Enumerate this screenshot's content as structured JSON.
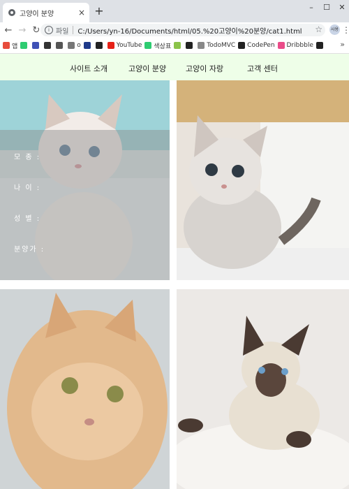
{
  "browser": {
    "tab_title": "고양이 분양",
    "new_tab": "+",
    "window_controls": {
      "minimize": "–",
      "maximize": "☐",
      "close": "✕"
    },
    "address": {
      "scheme_label": "파일",
      "url": "C:/Users/yn-16/Documents/html/05.%20고양이%20분양/cat1.html"
    },
    "profile_label": "사용",
    "bookmarks": [
      {
        "label": "앱",
        "color": "#e74c3c"
      },
      {
        "label": "",
        "color": "#2ecc71"
      },
      {
        "label": "",
        "color": "#3f51b5"
      },
      {
        "label": "",
        "color": "#333333"
      },
      {
        "label": "",
        "color": "#555555"
      },
      {
        "label": "o",
        "color": "#777777"
      },
      {
        "label": "",
        "color": "#1e3a8a"
      },
      {
        "label": "",
        "color": "#222222"
      },
      {
        "label": "YouTube",
        "color": "#e62117"
      },
      {
        "label": "색상표",
        "color": "#2ecc71"
      },
      {
        "label": "",
        "color": "#8bc34a"
      },
      {
        "label": "",
        "color": "#222222"
      },
      {
        "label": "TodoMVC",
        "color": "#888888"
      },
      {
        "label": "CodePen",
        "color": "#222222"
      },
      {
        "label": "Dribbble",
        "color": "#ea4c89"
      },
      {
        "label": "",
        "color": "#222222"
      }
    ],
    "bookmarks_more": "»"
  },
  "site": {
    "nav": [
      "사이트 소개",
      "고양이 분양",
      "고양이 자랑",
      "고객 센터"
    ],
    "cat_info_labels": [
      "모 종 :",
      "나 이 :",
      "성 별 :",
      "분양가 :"
    ]
  }
}
